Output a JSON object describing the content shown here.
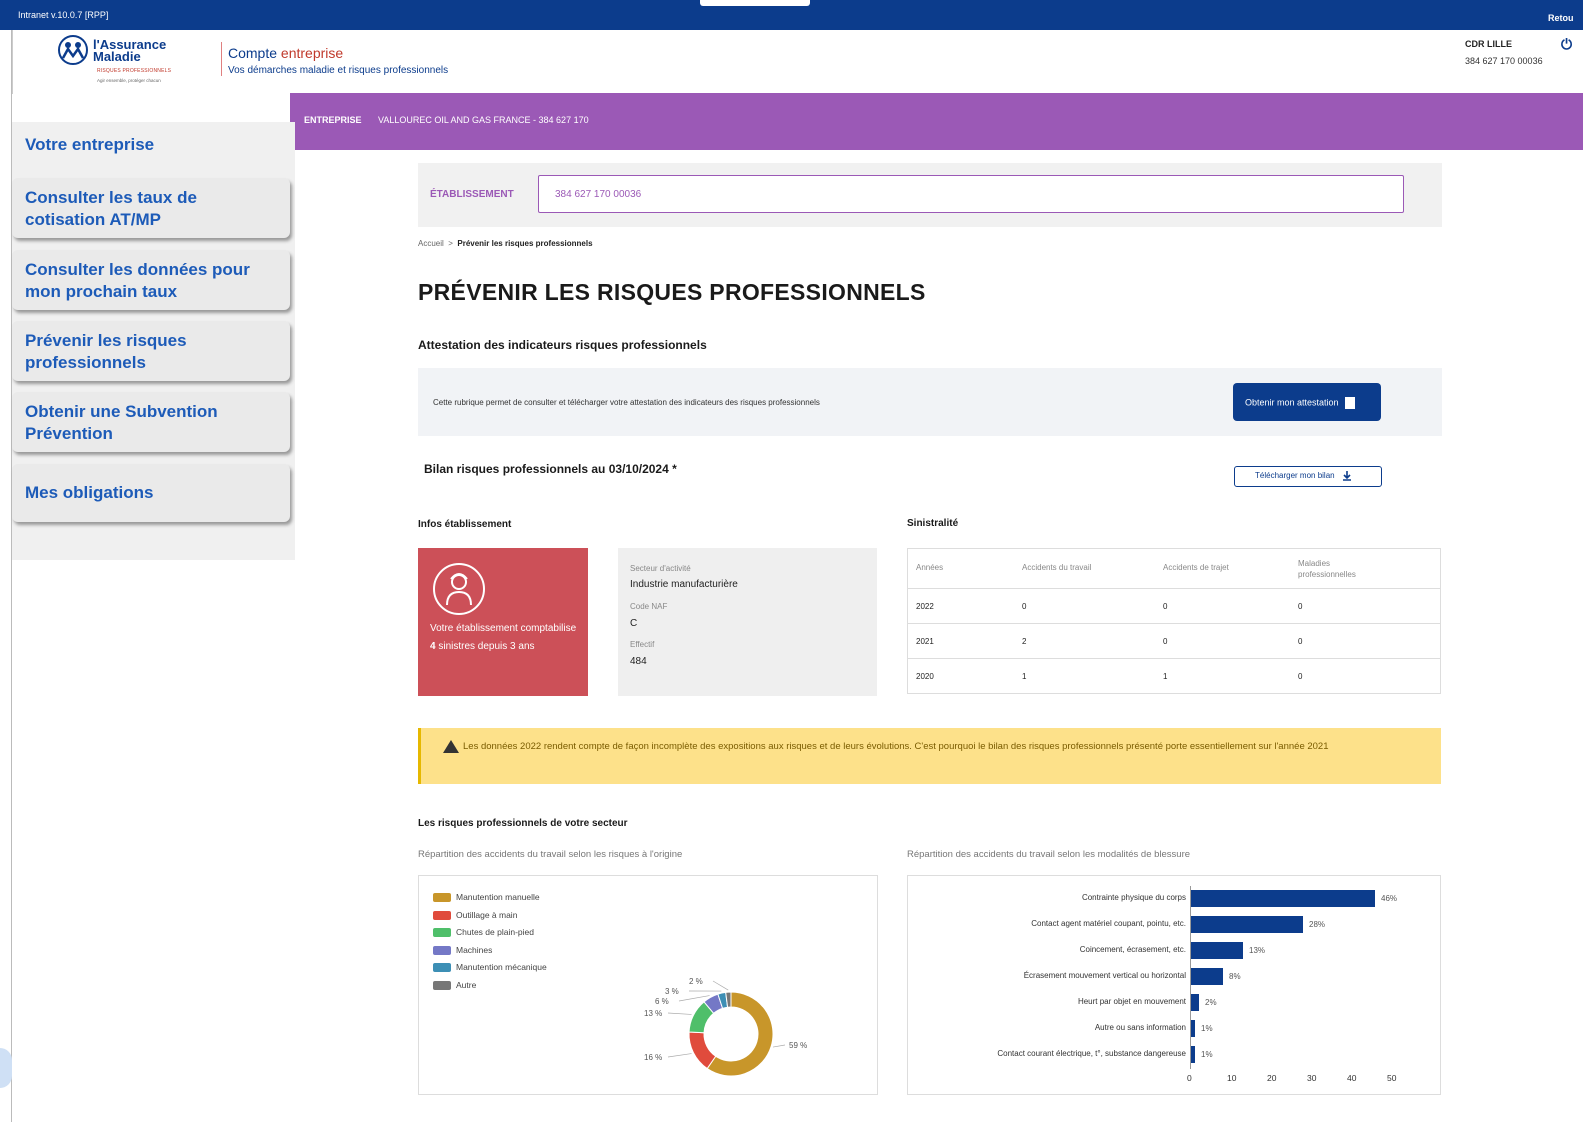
{
  "topbar": {
    "version": "Intranet v.10.0.7 [RPP]",
    "return_label": "Retou"
  },
  "header": {
    "logo_line1": "l'Assurance",
    "logo_line2": "Maladie",
    "logo_line3": "RISQUES PROFESSIONNELS",
    "logo_line4": "Agir ensemble, protéger chacun",
    "title_main": "Compte ",
    "title_accent": "entreprise",
    "subtitle": "Vos démarches maladie et risques professionnels",
    "caisse": "CDR LILLE",
    "caisse_number": "384 627 170 00036",
    "power_glyph": "⏻"
  },
  "banner": {
    "key": "ENTREPRISE",
    "value": "VALLOUREC OIL AND GAS FRANCE - 384 627 170"
  },
  "sidebar": {
    "items": [
      {
        "label": "Votre entreprise"
      },
      {
        "label": "Consulter les taux de cotisation AT/MP"
      },
      {
        "label": "Consulter les données pour mon prochain taux"
      },
      {
        "label": "Prévenir les risques professionnels"
      },
      {
        "label": "Obtenir une Subvention Prévention"
      },
      {
        "label": "Mes obligations"
      }
    ]
  },
  "etablissement": {
    "label": "ÉTABLISSEMENT",
    "value": "384 627 170 00036"
  },
  "breadcrumb": {
    "home": "Accueil",
    "sep": ">",
    "current": "Prévenir les risques professionnels"
  },
  "page_title": "PRÉVENIR LES RISQUES PROFESSIONNELS",
  "attestation": {
    "heading": "Attestation des indicateurs risques professionnels",
    "text": "Cette rubrique permet de consulter et télécharger votre attestation des indicateurs des risques professionnels",
    "button": "Obtenir mon attestation"
  },
  "bilan": {
    "heading": "Bilan risques professionnels au 03/10/2024 *",
    "button": "Télécharger mon bilan"
  },
  "infos": {
    "heading": "Infos établissement",
    "red_text_1": "Votre établissement comptabilise ",
    "red_count": "4",
    "red_text_2": " sinistres depuis 3 ans",
    "secteur_label": "Secteur d'activité",
    "secteur_value": "Industrie manufacturière",
    "naf_label": "Code NAF",
    "naf_value": "C",
    "effectif_label": "Effectif",
    "effectif_value": "484"
  },
  "sinistralite": {
    "heading": "Sinistralité",
    "headers": [
      "Années",
      "Accidents du travail",
      "Accidents de trajet",
      "Maladies professionnelles"
    ],
    "rows": [
      [
        "2022",
        "0",
        "0",
        "0"
      ],
      [
        "2021",
        "2",
        "0",
        "0"
      ],
      [
        "2020",
        "1",
        "1",
        "0"
      ]
    ]
  },
  "warning": "Les données 2022 rendent compte de façon incomplète des expositions aux risques et de leurs évolutions. C'est pourquoi le bilan des risques professionnels présenté porte essentiellement sur l'année 2021",
  "risques": {
    "heading": "Les risques professionnels de votre secteur",
    "donut_subtitle": "Répartition des accidents du travail selon les risques à l'origine",
    "bar_subtitle": "Répartition des accidents du travail selon les modalités de blessure"
  },
  "colors": {
    "brand": "#0c3c8c",
    "purple": "#9b59b6",
    "red_card": "#cc5058",
    "warning": "#fde18a"
  },
  "chart_data": [
    {
      "type": "pie",
      "categories": [
        "Manutention manuelle",
        "Outillage à main",
        "Chutes de plain-pied",
        "Machines",
        "Manutention mécanique",
        "Autre"
      ],
      "values": [
        59,
        16,
        13,
        6,
        3,
        2
      ],
      "value_labels": [
        "59 %",
        "16 %",
        "13 %",
        "6 %",
        "3 %",
        "2 %"
      ],
      "colors": [
        "#c8962a",
        "#e04b3c",
        "#4fbf6a",
        "#7478c6",
        "#3d8fb5",
        "#777777"
      ]
    },
    {
      "type": "bar",
      "categories": [
        "Contrainte physique du corps",
        "Contact agent matériel coupant, pointu, etc.",
        "Coincement, écrasement, etc.",
        "Écrasement mouvement vertical ou horizontal",
        "Heurt par objet en mouvement",
        "Autre ou sans information",
        "Contact courant électrique, t°, substance dangereuse"
      ],
      "values": [
        46,
        28,
        13,
        8,
        2,
        1,
        1
      ],
      "value_labels": [
        "46%",
        "28%",
        "13%",
        "8%",
        "2%",
        "1%",
        "1%"
      ],
      "xticks": [
        "0",
        "10",
        "20",
        "30",
        "40",
        "50"
      ],
      "xlim": [
        0,
        50
      ]
    }
  ]
}
